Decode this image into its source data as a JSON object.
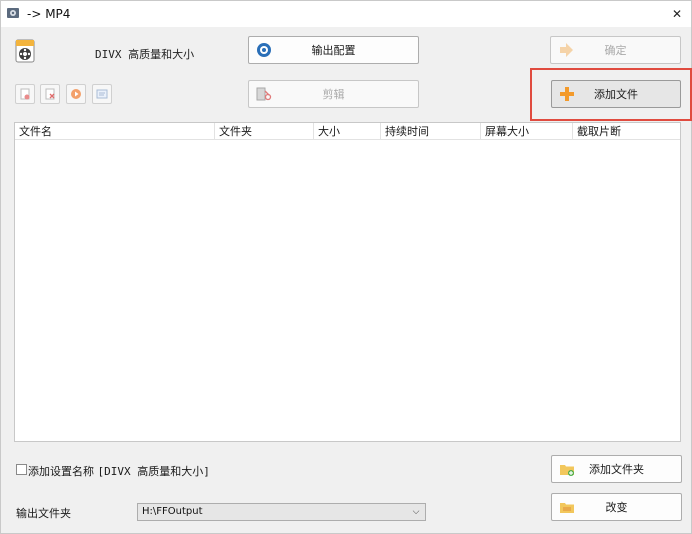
{
  "window": {
    "title": "-> MP4",
    "close_glyph": "✕"
  },
  "profile": {
    "text": "DIVX 高质量和大小",
    "icon": "film-reel-icon"
  },
  "buttons": {
    "output_config": "输出配置",
    "clip": "剪辑",
    "ok": "确定",
    "add_file": "添加文件",
    "add_folder": "添加文件夹",
    "change": "改变"
  },
  "toolbar_icons": [
    "remove-file-icon",
    "clear-list-icon",
    "play-icon",
    "media-info-icon"
  ],
  "file_list": {
    "columns": [
      "文件名",
      "文件夹",
      "大小",
      "持续时间",
      "屏幕大小",
      "截取片断"
    ],
    "rows": []
  },
  "save_setting": {
    "label_prefix": "添加设置名称",
    "label_value": "[DIVX 高质量和大小]",
    "checked": false
  },
  "output_folder": {
    "label": "输出文件夹",
    "value": "H:\\FFOutput"
  },
  "colors": {
    "highlight": "#e04b3f",
    "accent_orange": "#f39a2b"
  }
}
